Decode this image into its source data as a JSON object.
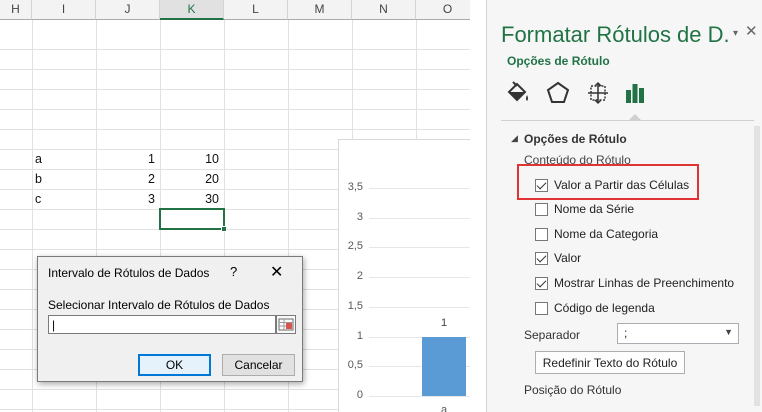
{
  "sheet": {
    "columns": [
      "H",
      "I",
      "J",
      "K",
      "L",
      "M",
      "N",
      "O"
    ],
    "selected_column": "K",
    "rows": [
      {
        "i": "a",
        "j": "1",
        "k": "10"
      },
      {
        "i": "b",
        "j": "2",
        "k": "20"
      },
      {
        "i": "c",
        "j": "3",
        "k": "30"
      }
    ]
  },
  "chart_data": {
    "type": "bar",
    "categories": [
      "a"
    ],
    "y_ticks": [
      "3,5",
      "3",
      "2,5",
      "2",
      "1,5",
      "1",
      "0,5",
      "0"
    ],
    "ylim": [
      0,
      3.5
    ],
    "values": [
      1
    ],
    "bar_label": "1",
    "bar_color": "#5b9bd5"
  },
  "dialog": {
    "title": "Intervalo de Rótulos de Dados",
    "help": "?",
    "close": "✕",
    "label": "Selecionar Intervalo de Rótulos de Dados",
    "input_value": "|",
    "ok": "OK",
    "cancel": "Cancelar"
  },
  "pane": {
    "title": "Formatar Rótulos de D...",
    "dropdown_glyph": "▾",
    "close_glyph": "✕",
    "subtitle": "Opções de Rótulo",
    "section": "Opções de Rótulo",
    "section_glyph": "◢",
    "content_label": "Conteúdo do Rótulo",
    "options": [
      {
        "label": "Valor a Partir das Células",
        "checked": true
      },
      {
        "label": "Nome da Série",
        "checked": false
      },
      {
        "label": "Nome da Categoria",
        "checked": false
      },
      {
        "label": "Valor",
        "checked": true
      },
      {
        "label": "Mostrar Linhas de Preenchimento",
        "checked": true
      },
      {
        "label": "Código de legenda",
        "checked": false
      }
    ],
    "separator_label": "Separador",
    "separator_value": ";",
    "separator_arrow": "▼",
    "reset_button": "Redefinir Texto do Rótulo",
    "position_label": "Posição do Rótulo",
    "accent": "#217346",
    "highlight": "#e03434"
  }
}
